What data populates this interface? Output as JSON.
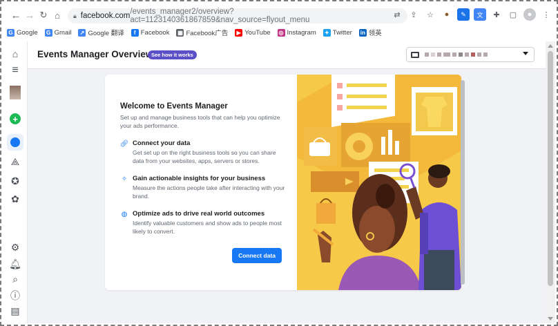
{
  "browser": {
    "url_host": "facebook.com",
    "url_path": "/events_manager2/overview?act=1123140361867859&nav_source=flyout_menu",
    "bookmarks": [
      {
        "label": "Google",
        "icon": "google-icon",
        "color": "#4285f4",
        "glyph": "G"
      },
      {
        "label": "Gmail",
        "icon": "gmail-icon",
        "color": "#4285f4",
        "glyph": "G"
      },
      {
        "label": "Google 翻译",
        "icon": "google-translate-icon",
        "color": "#4285f4",
        "glyph": "↗"
      },
      {
        "label": "Facebook",
        "icon": "facebook-icon",
        "color": "#1877f2",
        "glyph": "f"
      },
      {
        "label": "Facebook广告",
        "icon": "facebook-ads-icon",
        "color": "#5f6368",
        "glyph": "▦"
      },
      {
        "label": "YouTube",
        "icon": "youtube-icon",
        "color": "#ff0000",
        "glyph": "▶"
      },
      {
        "label": "Instagram",
        "icon": "instagram-icon",
        "color": "#c13584",
        "glyph": "◎"
      },
      {
        "label": "Twitter",
        "icon": "twitter-icon",
        "color": "#1da1f2",
        "glyph": "✦"
      },
      {
        "label": "领英",
        "icon": "linkedin-icon",
        "color": "#0a66c2",
        "glyph": "in"
      }
    ]
  },
  "header": {
    "title": "Events Manager Overview",
    "see_how": "See how it works"
  },
  "card": {
    "title": "Welcome to Events Manager",
    "description": "Set up and manage business tools that can help you optimize your ads performance.",
    "features": [
      {
        "icon": "link-icon",
        "title": "Connect your data",
        "description": "Get set up on the right business tools so you can share data from your websites, apps, servers or stores."
      },
      {
        "icon": "sparkle-chart-icon",
        "title": "Gain actionable insights for your business",
        "description": "Measure the actions people take after interacting with your brand."
      },
      {
        "icon": "globe-icon",
        "title": "Optimize ads to drive real world outcomes",
        "description": "Identify valuable customers and show ads to people most likely to convert."
      }
    ],
    "button_label": "Connect data"
  },
  "colors": {
    "accent": "#1877f2",
    "badge": "#5b4fc7",
    "illustration_bg": "#f7c948"
  }
}
